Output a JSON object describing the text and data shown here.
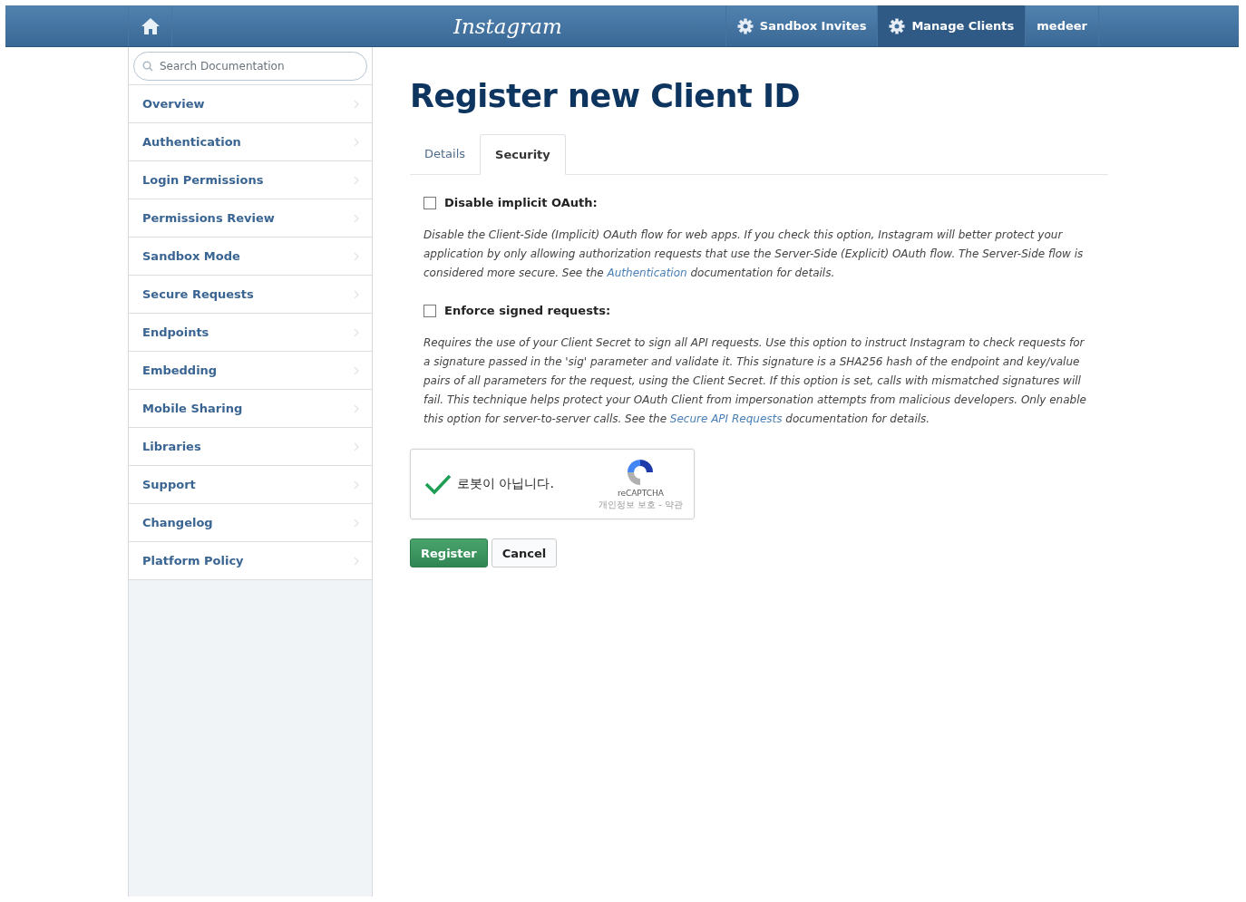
{
  "header": {
    "logo": "Instagram",
    "nav": [
      {
        "label": "Sandbox Invites",
        "kind": "menu",
        "selected": false
      },
      {
        "label": "Manage Clients",
        "kind": "menu",
        "selected": true
      },
      {
        "label": "medeer",
        "kind": "user",
        "selected": false
      }
    ]
  },
  "sidebar": {
    "search": {
      "placeholder": "Search Documentation"
    },
    "items": [
      "Overview",
      "Authentication",
      "Login Permissions",
      "Permissions Review",
      "Sandbox Mode",
      "Secure Requests",
      "Endpoints",
      "Embedding",
      "Mobile Sharing",
      "Libraries",
      "Support",
      "Changelog",
      "Platform Policy"
    ]
  },
  "page_title": "Register new Client ID",
  "tabs": [
    {
      "label": "Details",
      "selected": false
    },
    {
      "label": "Security",
      "selected": true
    }
  ],
  "options": [
    {
      "label": "Disable implicit OAuth:",
      "checked": false,
      "text_before": "Disable the Client-Side (Implicit) OAuth flow for web apps. If you check this option, Instagram will better protect your application by only allowing authorization requests that use the Server-Side (Explicit) OAuth flow. The Server-Side flow is considered more secure. See the",
      "link": "Authentication",
      "text_after": "documentation for details."
    },
    {
      "label": "Enforce signed requests:",
      "checked": false,
      "text_before": "Requires the use of your Client Secret to sign all API requests. Use this option to instruct Instagram to check requests for a signature passed in the 'sig' parameter and validate it. This signature is a SHA256 hash of the endpoint and key/value pairs of all parameters for the request, using the Client Secret. If this option is set, calls with mismatched signatures will fail. This technique helps protect your OAuth Client from impersonation attempts from malicious developers. Only enable this option for server-to-server calls. See the",
      "link": "Secure API Requests",
      "text_after": "documentation for details."
    }
  ],
  "captcha": {
    "checked": true,
    "label": "로봇이 아닙니다.",
    "brand": "reCAPTCHA",
    "footer": "개인정보 보호 - 약관"
  },
  "buttons": [
    {
      "label": "Register",
      "kind": "primary"
    },
    {
      "label": "Cancel",
      "kind": "secondary"
    }
  ]
}
